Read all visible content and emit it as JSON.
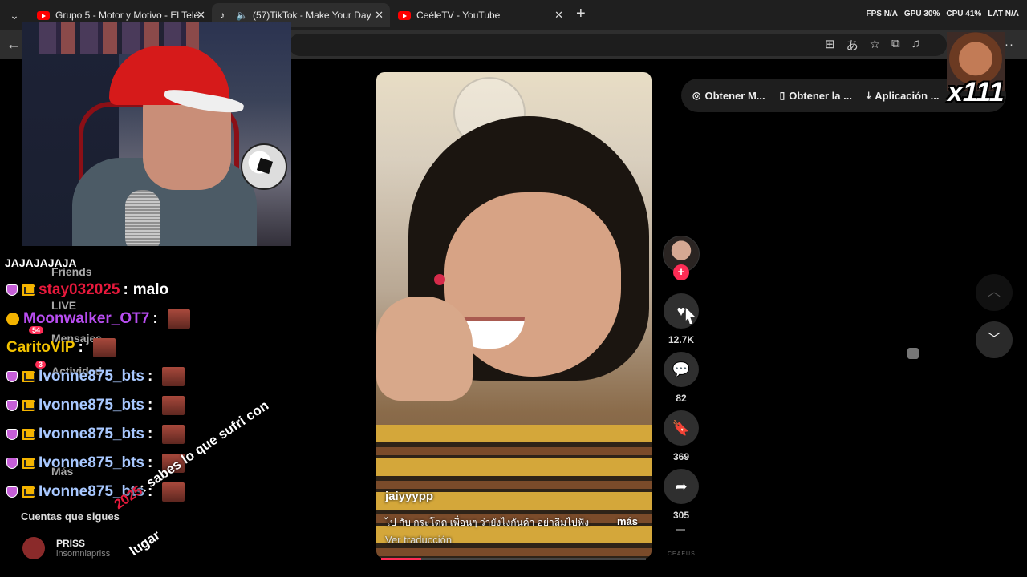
{
  "tabs": [
    {
      "title": "Grupo 5 - Motor y Motivo - El Telé",
      "icon": "youtube-icon"
    },
    {
      "title": "(57)TikTok - Make Your Day",
      "icon": "tiktok-icon",
      "active": true
    },
    {
      "title": "CeéleTV - YouTube",
      "icon": "youtube-icon"
    }
  ],
  "stats": {
    "fps": "FPS N/A",
    "gpu": "GPU 30%",
    "cpu": "CPU 41%",
    "lat": "LAT N/A"
  },
  "sidebar": {
    "friends": "Friends",
    "live": "LIVE",
    "messages": "Mensajes",
    "messages_count": "54",
    "activity": "Actividad",
    "activity_count": "3",
    "more": "Más",
    "following": "Cuentas que sigues",
    "follow_name": "PRISS",
    "follow_handle": "insomniapriss",
    "header_text": "JAJAJAJAJA"
  },
  "chat": [
    {
      "user": "stay032025",
      "sep": ":",
      "msg": "malo",
      "color": "#e8193c",
      "badges": [
        "shield",
        "crown"
      ]
    },
    {
      "user": "Moonwalker_OT7",
      "sep": ":",
      "msg": "",
      "color": "#b84df0",
      "badges": [
        "emoji"
      ],
      "emote": true
    },
    {
      "user": "CaritoVIP",
      "sep": ":",
      "msg": "",
      "color": "#f2c200",
      "badges": [],
      "emote": true
    },
    {
      "user": "Ivonne875_bts",
      "sep": ":",
      "msg": "",
      "color": "#a8c8ff",
      "badges": [
        "shield",
        "crown"
      ],
      "emote": true
    },
    {
      "user": "Ivonne875_bts",
      "sep": ":",
      "msg": "",
      "color": "#a8c8ff",
      "badges": [
        "shield",
        "crown"
      ],
      "emote": true
    },
    {
      "user": "Ivonne875_bts",
      "sep": ":",
      "msg": "",
      "color": "#a8c8ff",
      "badges": [
        "shield",
        "crown"
      ],
      "emote": true
    },
    {
      "user": "Ivonne875_bts",
      "sep": ":",
      "msg": "",
      "color": "#a8c8ff",
      "badges": [
        "shield",
        "crown"
      ],
      "emote": true
    },
    {
      "user": "Ivonne875_bts",
      "sep": ":",
      "msg": "",
      "color": "#a8c8ff",
      "badges": [
        "shield",
        "crown"
      ],
      "emote": true
    }
  ],
  "floating_msg": {
    "user": "2025",
    "text": ": sabes lo que sufri con",
    "text2": "lugar"
  },
  "video": {
    "username": "jaiyyypp",
    "caption": "ไป กับ กระโดด เพื่อนๆ ว่ายังไงกันค้า อย่าลืมไปฟัง",
    "more": "más",
    "translate": "Ver traducción",
    "progress": 0.15
  },
  "actions": {
    "likes": "12.7K",
    "comments": "82",
    "saves": "369",
    "shares": "305",
    "rail_label": "CEAEUS"
  },
  "top_bar": [
    {
      "label": "Obtener M...",
      "icon": "coin-icon"
    },
    {
      "label": "Obtener la ...",
      "icon": "phone-icon"
    },
    {
      "label": "Aplicación ...",
      "icon": "download-icon"
    }
  ],
  "overlay": {
    "multiplier": "x111"
  },
  "colors": {
    "accent": "#fe2c55",
    "bg": "#000000",
    "tabbar": "#1f1f1f"
  }
}
